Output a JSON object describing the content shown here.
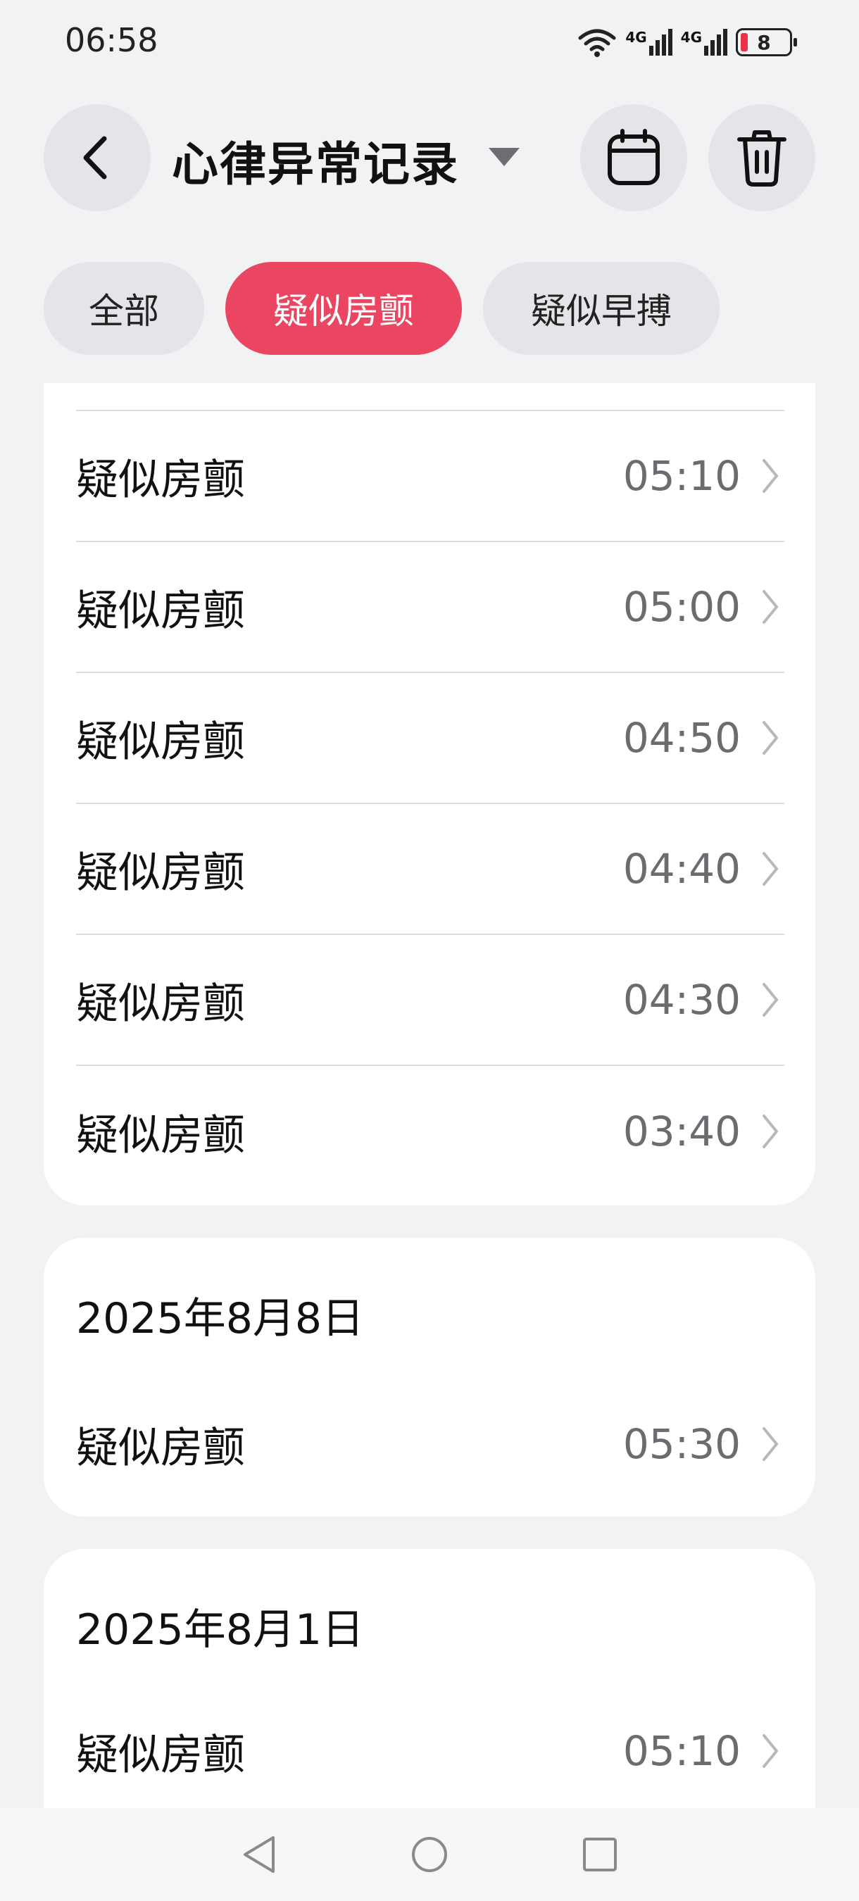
{
  "status_bar": {
    "time": "06:58",
    "signal_1": "4G",
    "signal_2": "4G",
    "battery": "8"
  },
  "header": {
    "title": "心律异常记录",
    "back_icon": "chevron-left-icon",
    "dropdown_icon": "triangle-down-icon",
    "calendar_icon": "calendar-icon",
    "delete_icon": "trash-icon"
  },
  "tabs": [
    {
      "label": "全部",
      "selected": false
    },
    {
      "label": "疑似房颤",
      "selected": true
    },
    {
      "label": "疑似早搏",
      "selected": false
    }
  ],
  "groups": [
    {
      "date": "",
      "records": [
        {
          "label": "疑似房颤",
          "time": "05:10"
        },
        {
          "label": "疑似房颤",
          "time": "05:00"
        },
        {
          "label": "疑似房颤",
          "time": "04:50"
        },
        {
          "label": "疑似房颤",
          "time": "04:40"
        },
        {
          "label": "疑似房颤",
          "time": "04:30"
        },
        {
          "label": "疑似房颤",
          "time": "03:40"
        }
      ]
    },
    {
      "date": "2025年8月8日",
      "records": [
        {
          "label": "疑似房颤",
          "time": "05:30"
        }
      ]
    },
    {
      "date": "2025年8月1日",
      "records": [
        {
          "label": "疑似房颤",
          "time": "05:10"
        }
      ]
    }
  ],
  "colors": {
    "accent": "#ea4561",
    "background": "#f1f2f4",
    "card": "#ffffff",
    "secondary_text": "#6b6b70"
  },
  "nav": {
    "back_icon": "triangle-back-icon",
    "home_icon": "circle-home-icon",
    "recents_icon": "square-recents-icon"
  }
}
